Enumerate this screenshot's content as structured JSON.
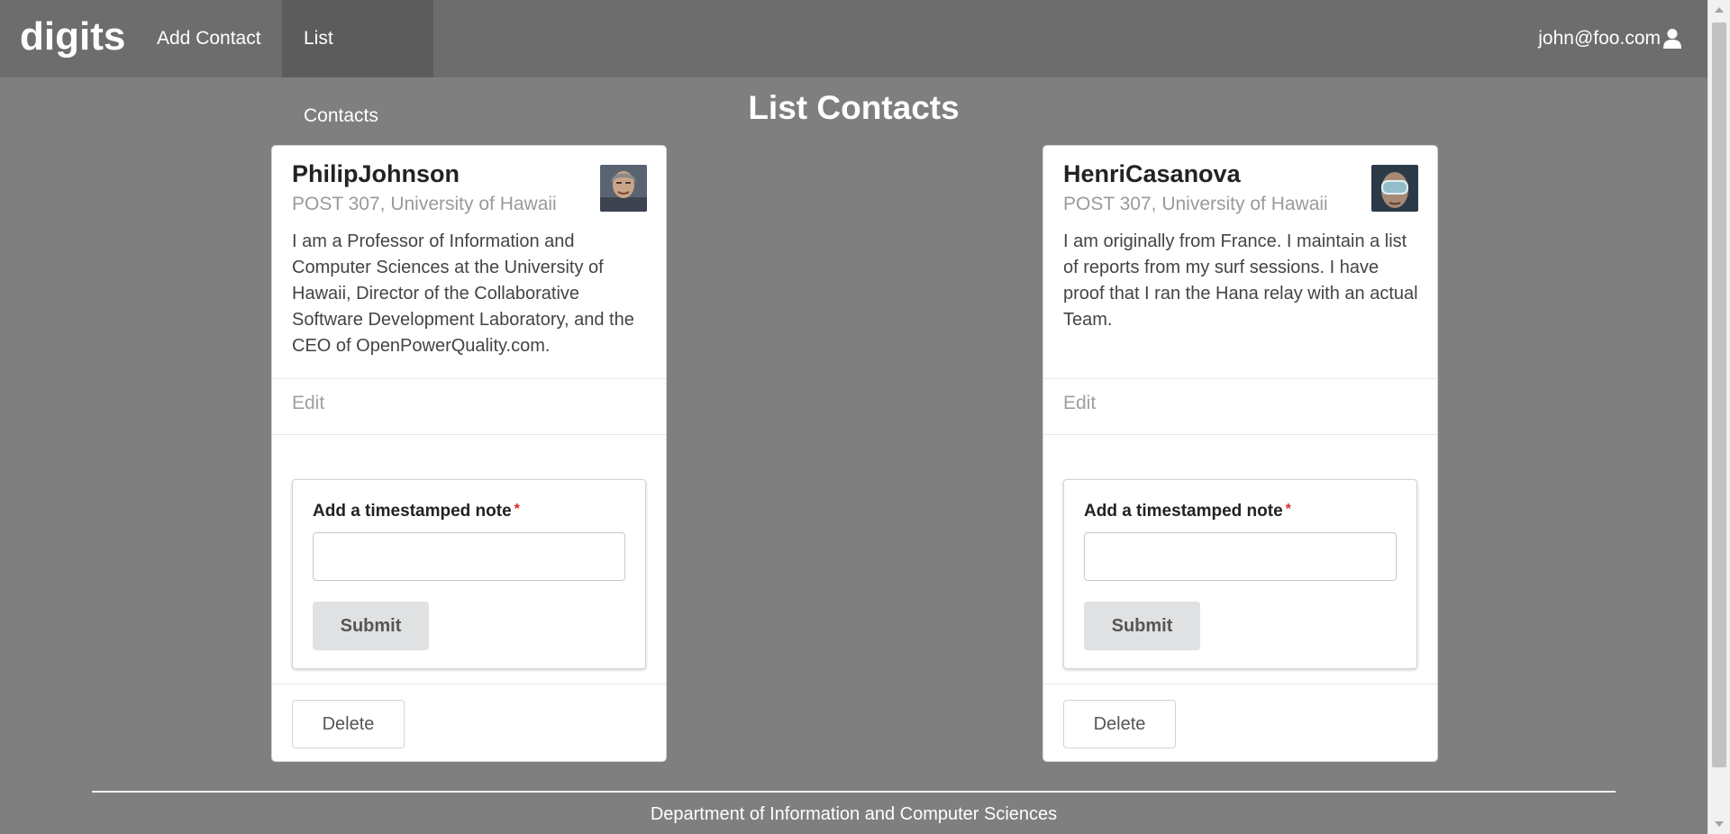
{
  "navbar": {
    "brand": "digits",
    "items": [
      {
        "label": "Add Contact"
      },
      {
        "label": "List Contacts"
      }
    ],
    "user_email": "john@foo.com"
  },
  "page": {
    "title": "List Contacts"
  },
  "contacts": [
    {
      "name": "PhilipJohnson",
      "address": "POST 307, University of Hawaii",
      "description": "I am a Professor of Information and Computer Sciences at the University of Hawaii, Director of the Collaborative Software Development Laboratory, and the CEO of OpenPowerQuality.com.",
      "edit_label": "Edit",
      "note_label": "Add a timestamped note",
      "note_value": "",
      "submit_label": "Submit",
      "delete_label": "Delete"
    },
    {
      "name": "HenriCasanova",
      "address": "POST 307, University of Hawaii",
      "description": "I am originally from France. I maintain a list of reports from my surf sessions. I have proof that I ran the Hana relay with an actual Team.",
      "edit_label": "Edit",
      "note_label": "Add a timestamped note",
      "note_value": "",
      "submit_label": "Submit",
      "delete_label": "Delete"
    }
  ],
  "footer": {
    "text": "Department of Information and Computer Sciences"
  },
  "required_marker": "*"
}
